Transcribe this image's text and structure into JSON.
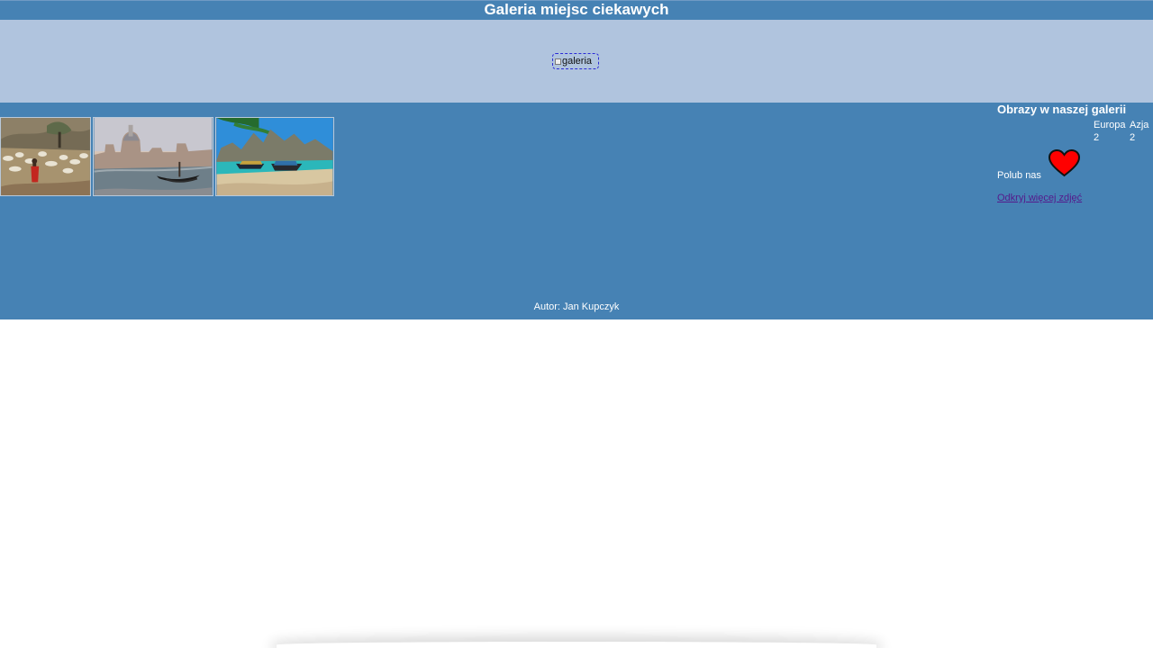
{
  "header": {
    "title": "Galeria miejsc ciekawych"
  },
  "banner": {
    "image_alt": "galeria"
  },
  "gallery": {
    "photos": [
      {
        "name": "gallery-photo-herd-icon"
      },
      {
        "name": "gallery-photo-venice-icon"
      },
      {
        "name": "gallery-photo-beach-icon"
      }
    ]
  },
  "aside": {
    "heading": "Obrazy w naszej galerii",
    "stats": [
      {
        "label": "Europa",
        "count": "2"
      },
      {
        "label": "Azja",
        "count": "2"
      }
    ],
    "like_label": "Polub nas",
    "more_link": "Odkryj więcej zdjęć"
  },
  "footer": {
    "author": "Autor: Jan Kupczyk"
  },
  "colors": {
    "page_background": "#ffffff",
    "header_background": "#4682b4",
    "banner_background": "#b0c4de",
    "link_color": "#551a8b",
    "heart_color": "#ff0000"
  },
  "icons": {
    "broken_image": "broken-image-icon",
    "heart": "heart-icon"
  }
}
